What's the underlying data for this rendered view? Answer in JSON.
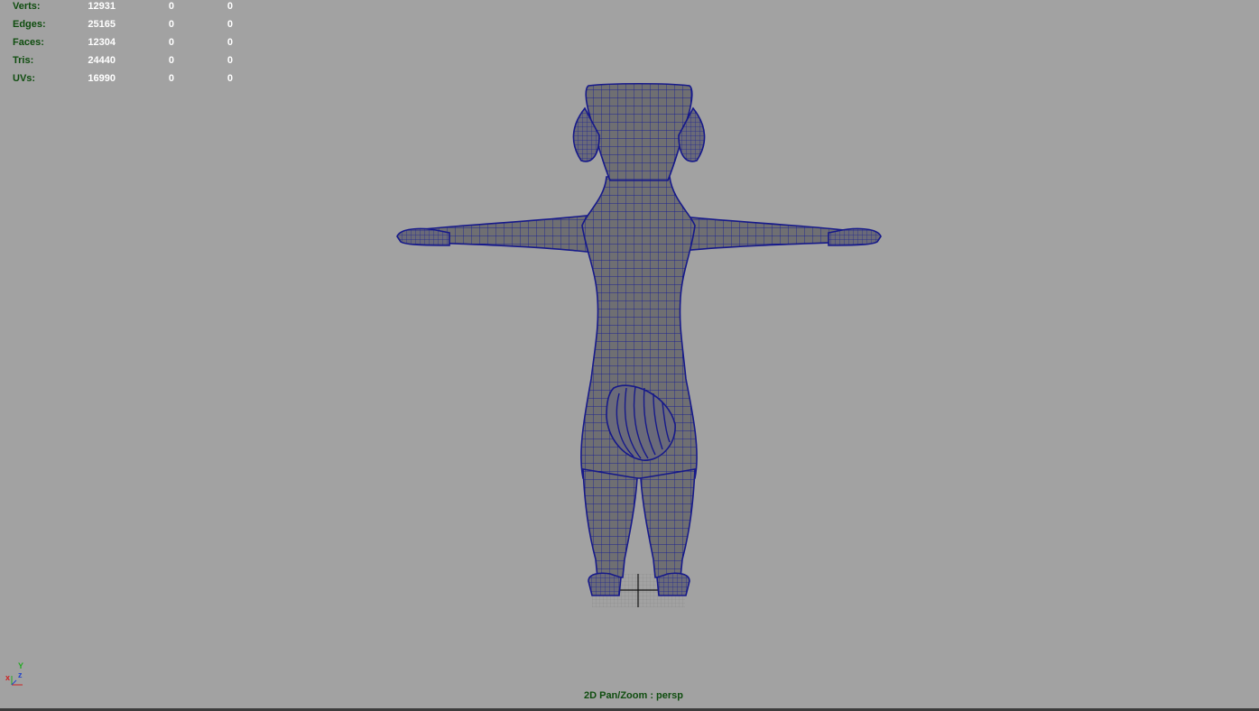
{
  "hud": {
    "rows": [
      {
        "label": "Verts:",
        "total": "12931",
        "selected": "0",
        "other": "0"
      },
      {
        "label": "Edges:",
        "total": "25165",
        "selected": "0",
        "other": "0"
      },
      {
        "label": "Faces:",
        "total": "12304",
        "selected": "0",
        "other": "0"
      },
      {
        "label": "Tris:",
        "total": "24440",
        "selected": "0",
        "other": "0"
      },
      {
        "label": "UVs:",
        "total": "16990",
        "selected": "0",
        "other": "0"
      }
    ]
  },
  "viewport": {
    "camera_label": "2D Pan/Zoom : persp"
  },
  "axis": {
    "x": "x",
    "y": "Y",
    "z": "z"
  },
  "colors": {
    "background": "#a2a2a2",
    "wireframe": "#1a1f8c",
    "mesh_fill": "#707070",
    "hud_label": "#0f4d0f",
    "hud_value": "#ffffff"
  }
}
